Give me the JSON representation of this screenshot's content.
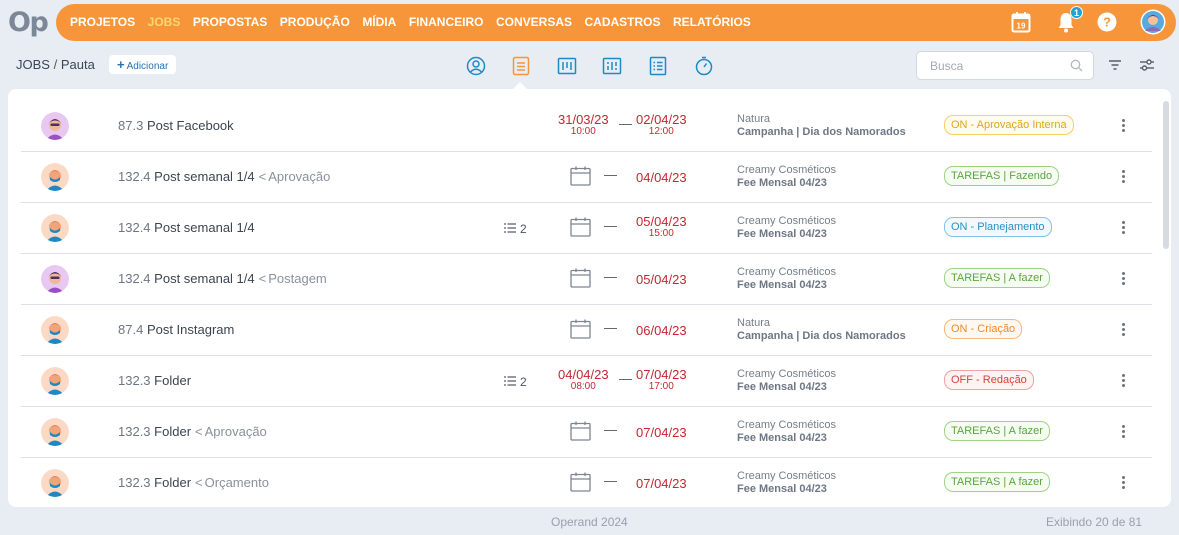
{
  "app": {
    "logo": "Op"
  },
  "nav": {
    "items": [
      "PROJETOS",
      "JOBS",
      "PROPOSTAS",
      "PRODUÇÃO",
      "MÍDIA",
      "FINANCEIRO",
      "CONVERSAS",
      "CADASTROS",
      "RELATÓRIOS"
    ],
    "active": "JOBS",
    "calendar_day": "19",
    "notifications_count": "1",
    "icons": [
      "calendar-icon",
      "bell-icon",
      "help-icon",
      "user-avatar"
    ]
  },
  "breadcrumb": {
    "section": "JOBS",
    "separator": "/",
    "page": "Pauta"
  },
  "add_button": {
    "plus": "+",
    "label": "Adicionar"
  },
  "view_icons": [
    "person-view-icon",
    "list-view-icon",
    "board-view-icon",
    "board-detail-view-icon",
    "checklist-view-icon",
    "timer-view-icon"
  ],
  "active_view": "list-view-icon",
  "search": {
    "placeholder": "Busca"
  },
  "rows": [
    {
      "avatar": "purple",
      "code": "87.3",
      "name": "Post Facebook",
      "stage": "",
      "subtasks": "",
      "show_calendar": false,
      "start_date": "31/03/23",
      "start_time": "10:00",
      "end_date": "02/04/23",
      "end_time": "12:00",
      "client": "Natura",
      "campaign": "Campanha | Dia dos Namorados",
      "status": "ON - Aprovação Interna",
      "status_style": "yellow"
    },
    {
      "avatar": "blue",
      "code": "132.4",
      "name": "Post semanal 1/4",
      "stage": "Aprovação",
      "subtasks": "",
      "show_calendar": true,
      "start_date": "",
      "start_time": "",
      "end_date": "04/04/23",
      "end_time": "",
      "client": "Creamy Cosméticos",
      "campaign": "Fee Mensal 04/23",
      "status": "TAREFAS | Fazendo",
      "status_style": "green"
    },
    {
      "avatar": "blue",
      "code": "132.4",
      "name": "Post semanal 1/4",
      "stage": "",
      "subtasks": "2",
      "show_calendar": true,
      "start_date": "",
      "start_time": "",
      "end_date": "05/04/23",
      "end_time": "15:00",
      "client": "Creamy Cosméticos",
      "campaign": "Fee Mensal 04/23",
      "status": "ON - Planejamento",
      "status_style": "blue"
    },
    {
      "avatar": "purple",
      "code": "132.4",
      "name": "Post semanal 1/4",
      "stage": "Postagem",
      "subtasks": "",
      "show_calendar": true,
      "start_date": "",
      "start_time": "",
      "end_date": "05/04/23",
      "end_time": "",
      "client": "Creamy Cosméticos",
      "campaign": "Fee Mensal 04/23",
      "status": "TAREFAS | A fazer",
      "status_style": "green"
    },
    {
      "avatar": "blue",
      "code": "87.4",
      "name": "Post Instagram",
      "stage": "",
      "subtasks": "",
      "show_calendar": true,
      "start_date": "",
      "start_time": "",
      "end_date": "06/04/23",
      "end_time": "",
      "client": "Natura",
      "campaign": "Campanha | Dia dos Namorados",
      "status": "ON - Criação",
      "status_style": "orange"
    },
    {
      "avatar": "blue",
      "code": "132.3",
      "name": "Folder",
      "stage": "",
      "subtasks": "2",
      "show_calendar": false,
      "start_date": "04/04/23",
      "start_time": "08:00",
      "end_date": "07/04/23",
      "end_time": "17:00",
      "client": "Creamy Cosméticos",
      "campaign": "Fee Mensal 04/23",
      "status": "OFF - Redação",
      "status_style": "red"
    },
    {
      "avatar": "blue",
      "code": "132.3",
      "name": "Folder",
      "stage": "Aprovação",
      "subtasks": "",
      "show_calendar": true,
      "start_date": "",
      "start_time": "",
      "end_date": "07/04/23",
      "end_time": "",
      "client": "Creamy Cosméticos",
      "campaign": "Fee Mensal 04/23",
      "status": "TAREFAS | A fazer",
      "status_style": "green"
    },
    {
      "avatar": "blue",
      "code": "132.3",
      "name": "Folder",
      "stage": "Orçamento",
      "subtasks": "",
      "show_calendar": true,
      "start_date": "",
      "start_time": "",
      "end_date": "07/04/23",
      "end_time": "",
      "client": "Creamy Cosméticos",
      "campaign": "Fee Mensal 04/23",
      "status": "TAREFAS | A fazer",
      "status_style": "green"
    }
  ],
  "row_dash": "—",
  "chevron": "<",
  "status_colors": {
    "yellow": {
      "text": "#e0a51c",
      "border": "#f3cf6a",
      "bg": "#fffcef"
    },
    "green": {
      "text": "#5aa63e",
      "border": "#9fd388",
      "bg": "#f6fcf2"
    },
    "blue": {
      "text": "#2a8fc1",
      "border": "#7fc6e6",
      "bg": "#f1f9fd"
    },
    "orange": {
      "text": "#ef8a2c",
      "border": "#f6b977",
      "bg": "#fff8f1"
    },
    "red": {
      "text": "#d9403c",
      "border": "#eea4a0",
      "bg": "#fdf3f2"
    }
  },
  "footer": {
    "copyright": "Operand 2024",
    "count": "Exibindo 20 de 81"
  },
  "colors": {
    "brand_orange": "#f7953a",
    "date_red": "#c4272f",
    "page_bg": "#e8ecf3",
    "accent_blue": "#1f8ac4"
  }
}
